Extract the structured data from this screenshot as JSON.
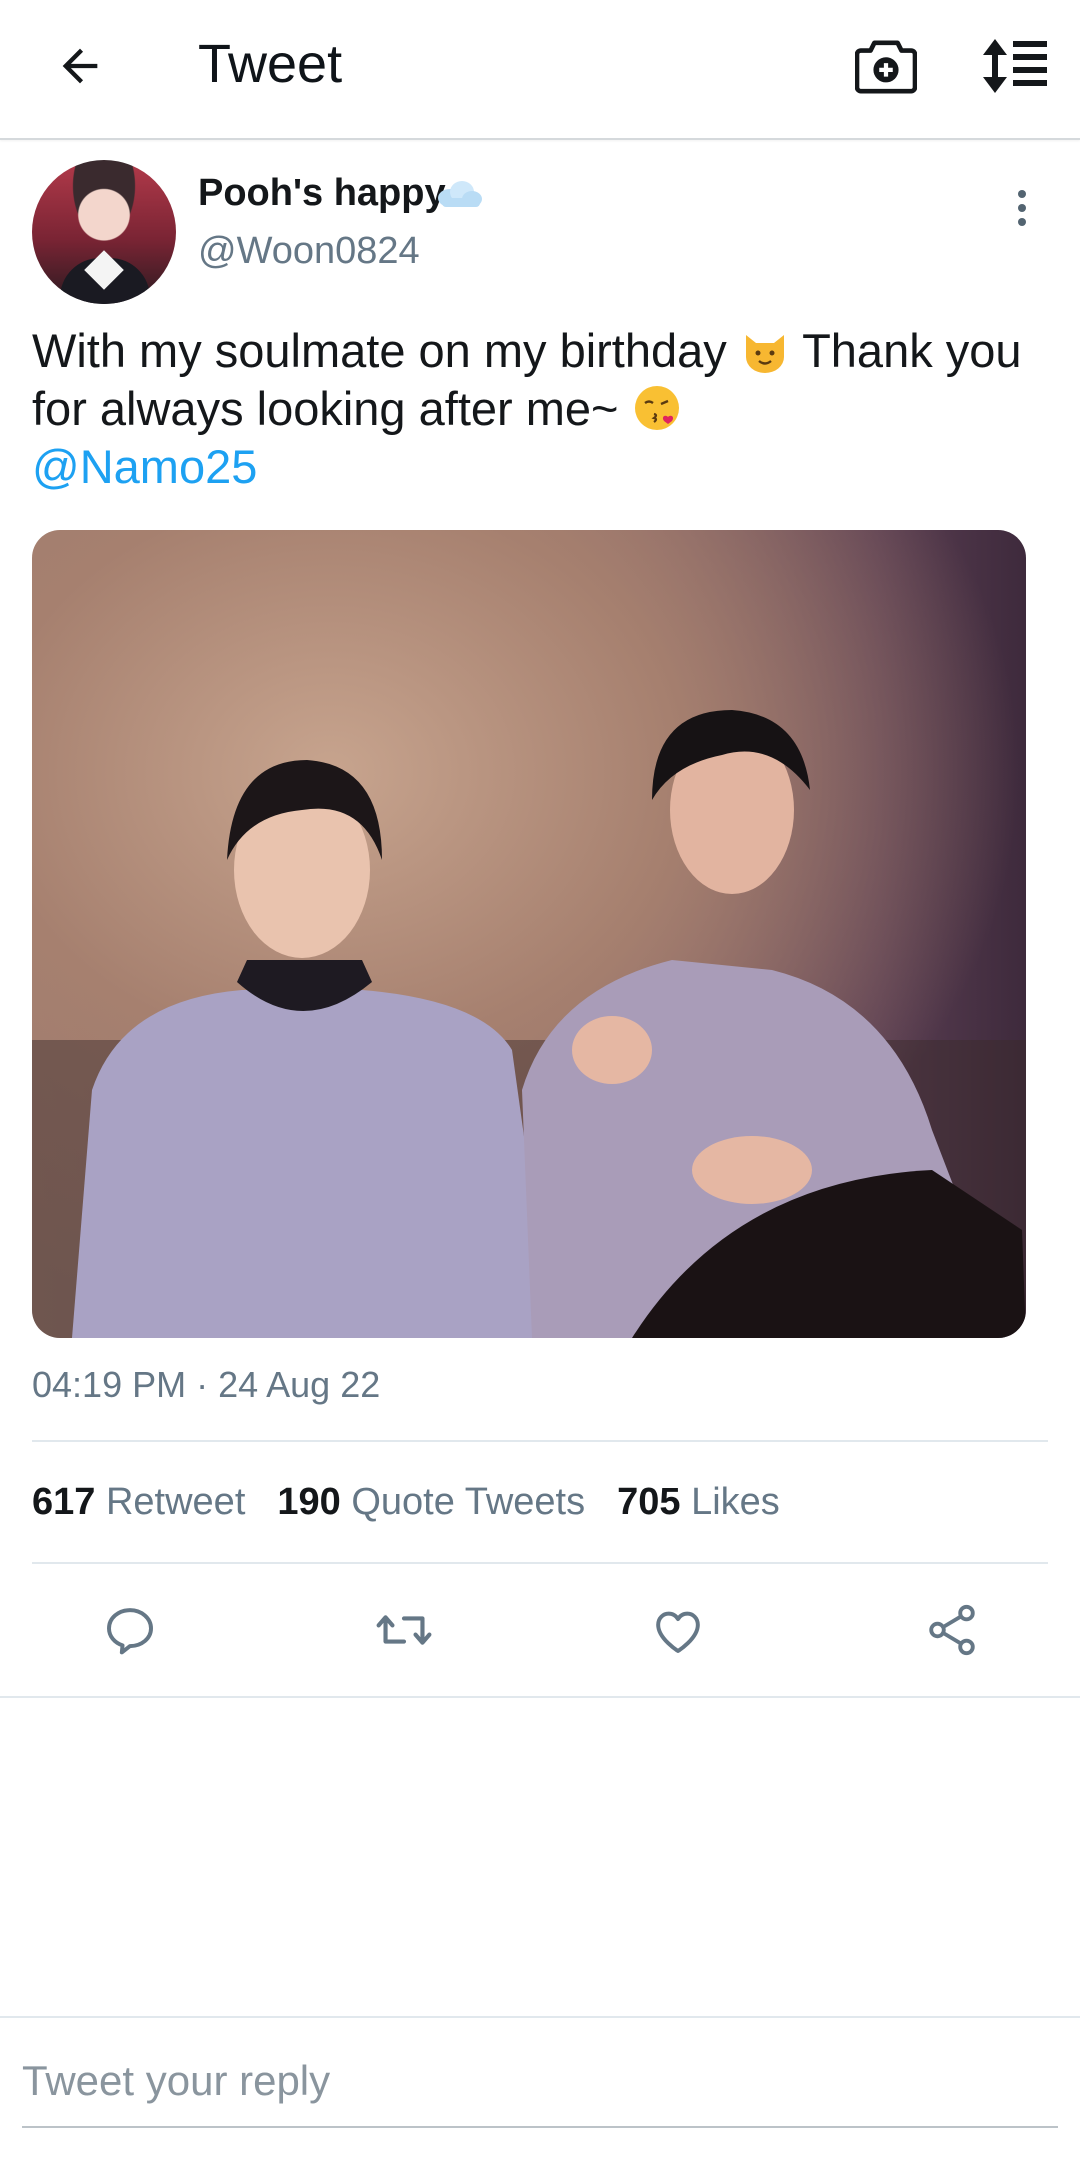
{
  "header": {
    "title": "Tweet",
    "back_icon": "arrow-left-icon",
    "camera_icon": "camera-plus-icon",
    "sort_icon": "sort-list-icon"
  },
  "tweet": {
    "display_name": "Pooh's happy",
    "name_emoji": "cloud-emoji",
    "handle": "@Woon0824",
    "text_part1": "With my soulmate on my birthday",
    "emoji1": "smiling-cat-emoji",
    "text_part2": "Thank you for always looking after me~",
    "emoji2": "kissing-face-emoji",
    "mention": "@Namo25",
    "timestamp": "04:19 PM · 24 Aug 22"
  },
  "stats": {
    "retweets_count": "617",
    "retweets_label": "Retweet",
    "quotes_count": "190",
    "quotes_label": "Quote Tweets",
    "likes_count": "705",
    "likes_label": "Likes"
  },
  "actions": [
    "reply-icon",
    "retweet-icon",
    "like-icon",
    "share-icon"
  ],
  "reply": {
    "placeholder": "Tweet your reply"
  },
  "colors": {
    "link": "#1da1f2",
    "secondary_text": "#657786",
    "divider": "#e1e8ed"
  }
}
